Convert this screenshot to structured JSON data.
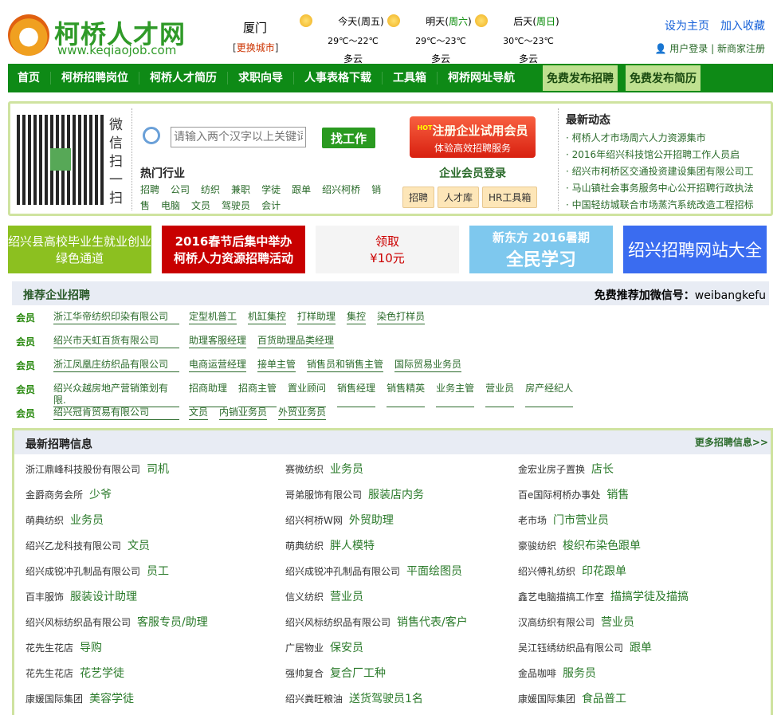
{
  "header": {
    "logo_title": "柯桥人才网",
    "logo_url": "www.keqiaojob.com",
    "city": "厦门",
    "change_city": "更换城市",
    "weather": [
      {
        "day": "今天",
        "weekday": "周五",
        "temp": "29℃～22℃",
        "cond": "多云"
      },
      {
        "day": "明天",
        "weekday": "周六",
        "temp": "29℃～23℃",
        "cond": "多云"
      },
      {
        "day": "后天",
        "weekday": "周日",
        "temp": "30℃～23℃",
        "cond": "多云"
      }
    ],
    "set_home": "设为主页",
    "add_fav": "加入收藏",
    "user_login": "用户登录",
    "sep": "|",
    "register": "新商家注册"
  },
  "nav": {
    "items": [
      "首页",
      "柯桥招聘岗位",
      "柯桥人才简历",
      "求职向导",
      "人事表格下载",
      "工具箱",
      "柯桥网址导航"
    ],
    "post_job": "免费发布招聘",
    "post_resume": "免费发布简历"
  },
  "panel": {
    "qr_text": "微信扫一扫",
    "search_placeholder": "请输入两个汉字以上关键词",
    "search_button": "找工作",
    "hot_title": "热门行业",
    "hot": [
      "招聘",
      "公司",
      "纺织",
      "兼职",
      "学徒",
      "跟单",
      "绍兴柯桥",
      "销售",
      "电脑",
      "文员",
      "驾驶员",
      "会计"
    ],
    "reg_badge": "HOT",
    "reg_title": "注册企业试用会员",
    "reg_sub": "体验高效招聘服务",
    "member_login": "企业会员登录",
    "member_buttons": [
      "招聘",
      "人才库",
      "HR工具箱"
    ],
    "news_title": "最新动态",
    "news": [
      "柯桥人才市场周六人力资源集市",
      "2016年绍兴科技馆公开招聘工作人员启",
      "绍兴市柯桥区交通投资建设集团有限公司工",
      "马山镇社会事务服务中心公开招聘行政执法",
      "中国轻纺城联合市场蒸汽系统改造工程招标"
    ]
  },
  "banners": [
    {
      "l1": "绍兴县高校毕业生就业创业",
      "l2": "绿色通道",
      "bg": "#8cc020"
    },
    {
      "l1": "2016春节后集中举办",
      "l2": "柯桥人力资源招聘活动",
      "bg": "#c80000"
    },
    {
      "l1": "领取",
      "l2": "¥10元",
      "bg": "#f4f4f4"
    },
    {
      "l1": "新东方 2016暑期",
      "l2": "全民学习",
      "bg": "#7ec8ee"
    },
    {
      "l1": "绍兴招聘网站大全",
      "l2": "",
      "bg": "#3a6cf0"
    }
  ],
  "recommend": {
    "title": "推荐企业招聘",
    "wechat_label": "免费推荐加微信号：",
    "wechat_id": "weibangkefu",
    "member": "会员",
    "rows": [
      {
        "company": "浙江华帝纺织印染有限公司",
        "jobs": [
          "定型机普工",
          "机缸集控",
          "打样助理",
          "集控",
          "染色打样员"
        ]
      },
      {
        "company": "绍兴市天虹百货有限公司",
        "jobs": [
          "助理客服经理",
          "百货助理品类经理"
        ]
      },
      {
        "company": "浙江凤凰庄纺织品有限公司",
        "jobs": [
          "电商运营经理",
          "接单主管",
          "销售员和销售主管",
          "国际贸易业务员"
        ]
      },
      {
        "company": "绍兴众越房地产营销策划有限.",
        "jobs": [
          "招商助理",
          "招商主管",
          "置业顾问",
          "销售经理",
          "销售精英",
          "业务主管",
          "营业员",
          "房产经纪人"
        ]
      },
      {
        "company": "绍兴冠肯贸易有限公司",
        "jobs": [
          "文员",
          "内销业务员",
          "外贸业务员"
        ]
      }
    ]
  },
  "latest": {
    "title": "最新招聘信息",
    "more": "更多招聘信息>>",
    "jobs": [
      [
        {
          "c": "浙江鼎峰科技股份有限公司",
          "j": "司机"
        },
        {
          "c": "赛微纺织",
          "j": "业务员"
        },
        {
          "c": "金宏业房子置换",
          "j": "店长"
        }
      ],
      [
        {
          "c": "金爵商务会所",
          "j": "少爷"
        },
        {
          "c": "哥弟服饰有限公司",
          "j": "服装店内务"
        },
        {
          "c": "百e国际柯桥办事处",
          "j": "销售"
        }
      ],
      [
        {
          "c": "萌典纺织",
          "j": "业务员"
        },
        {
          "c": "绍兴柯桥W网",
          "j": "外贸助理"
        },
        {
          "c": "老市场",
          "j": "门市营业员"
        }
      ],
      [
        {
          "c": "绍兴乙龙科技有限公司",
          "j": "文员"
        },
        {
          "c": "萌典纺织",
          "j": "胖人模特"
        },
        {
          "c": "豪骏纺织",
          "j": "梭织布染色跟单"
        }
      ],
      [
        {
          "c": "绍兴成锐冲孔制品有限公司",
          "j": "员工"
        },
        {
          "c": "绍兴成锐冲孔制品有限公司",
          "j": "平面绘图员"
        },
        {
          "c": "绍兴傅礼纺织",
          "j": "印花跟单"
        }
      ],
      [
        {
          "c": "百丰服饰",
          "j": "服装设计助理"
        },
        {
          "c": "信义纺织",
          "j": "营业员"
        },
        {
          "c": "鑫艺电脑描搞工作室",
          "j": "描搞学徒及描搞"
        }
      ],
      [
        {
          "c": "绍兴风标纺织品有限公司",
          "j": "客服专员/助理"
        },
        {
          "c": "绍兴风标纺织品有限公司",
          "j": "销售代表/客户"
        },
        {
          "c": "汉高纺织有限公司",
          "j": "营业员"
        }
      ],
      [
        {
          "c": "花先生花店",
          "j": "导购"
        },
        {
          "c": "广居物业",
          "j": "保安员"
        },
        {
          "c": "吴江钰绣纺织品有限公司",
          "j": "跟单"
        }
      ],
      [
        {
          "c": "花先生花店",
          "j": "花艺学徒"
        },
        {
          "c": "强帅复合",
          "j": "复合厂工种"
        },
        {
          "c": "金品咖啡",
          "j": "服务员"
        }
      ],
      [
        {
          "c": "康媛国际集团",
          "j": "美容学徒"
        },
        {
          "c": "绍兴粪旺粮油",
          "j": "送货驾驶员1名"
        },
        {
          "c": "康媛国际集团",
          "j": "食品普工"
        }
      ]
    ]
  }
}
